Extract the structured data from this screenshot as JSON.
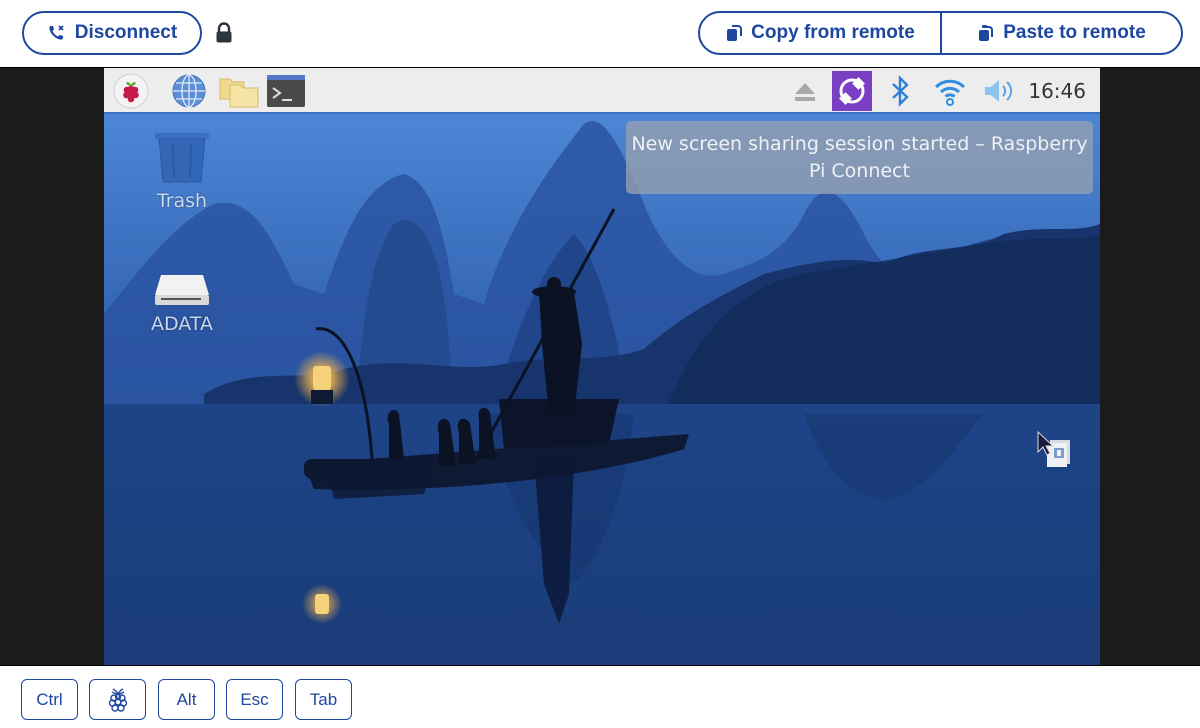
{
  "toolbar": {
    "disconnect_label": "Disconnect",
    "disconnect_icon": "phone-disconnect-icon",
    "lock_icon": "lock-icon",
    "copy_label": "Copy from remote",
    "copy_icon": "clipboard-copy-icon",
    "paste_label": "Paste to remote",
    "paste_icon": "clipboard-paste-icon"
  },
  "remote": {
    "taskbar": {
      "left_icons": [
        "raspberry-menu-icon",
        "web-browser-icon",
        "file-manager-icon",
        "terminal-icon"
      ],
      "tray_icons": [
        "eject-icon",
        "connect-icon",
        "bluetooth-icon",
        "wifi-icon",
        "volume-icon"
      ],
      "clock": "16:46"
    },
    "desktop_icons": [
      {
        "label": "Trash",
        "icon": "trash-icon"
      },
      {
        "label": "ADATA",
        "icon": "drive-icon"
      }
    ],
    "notification": "New screen sharing session started – Raspberry Pi Connect"
  },
  "keys": [
    {
      "label": "Ctrl"
    },
    {
      "label": "",
      "icon": "raspberry-key-icon"
    },
    {
      "label": "Alt"
    },
    {
      "label": "Esc"
    },
    {
      "label": "Tab"
    }
  ],
  "colors": {
    "accent": "#1d47a0",
    "connect_tray": "#7b3fc4",
    "bluetooth": "#2f7fd8"
  }
}
